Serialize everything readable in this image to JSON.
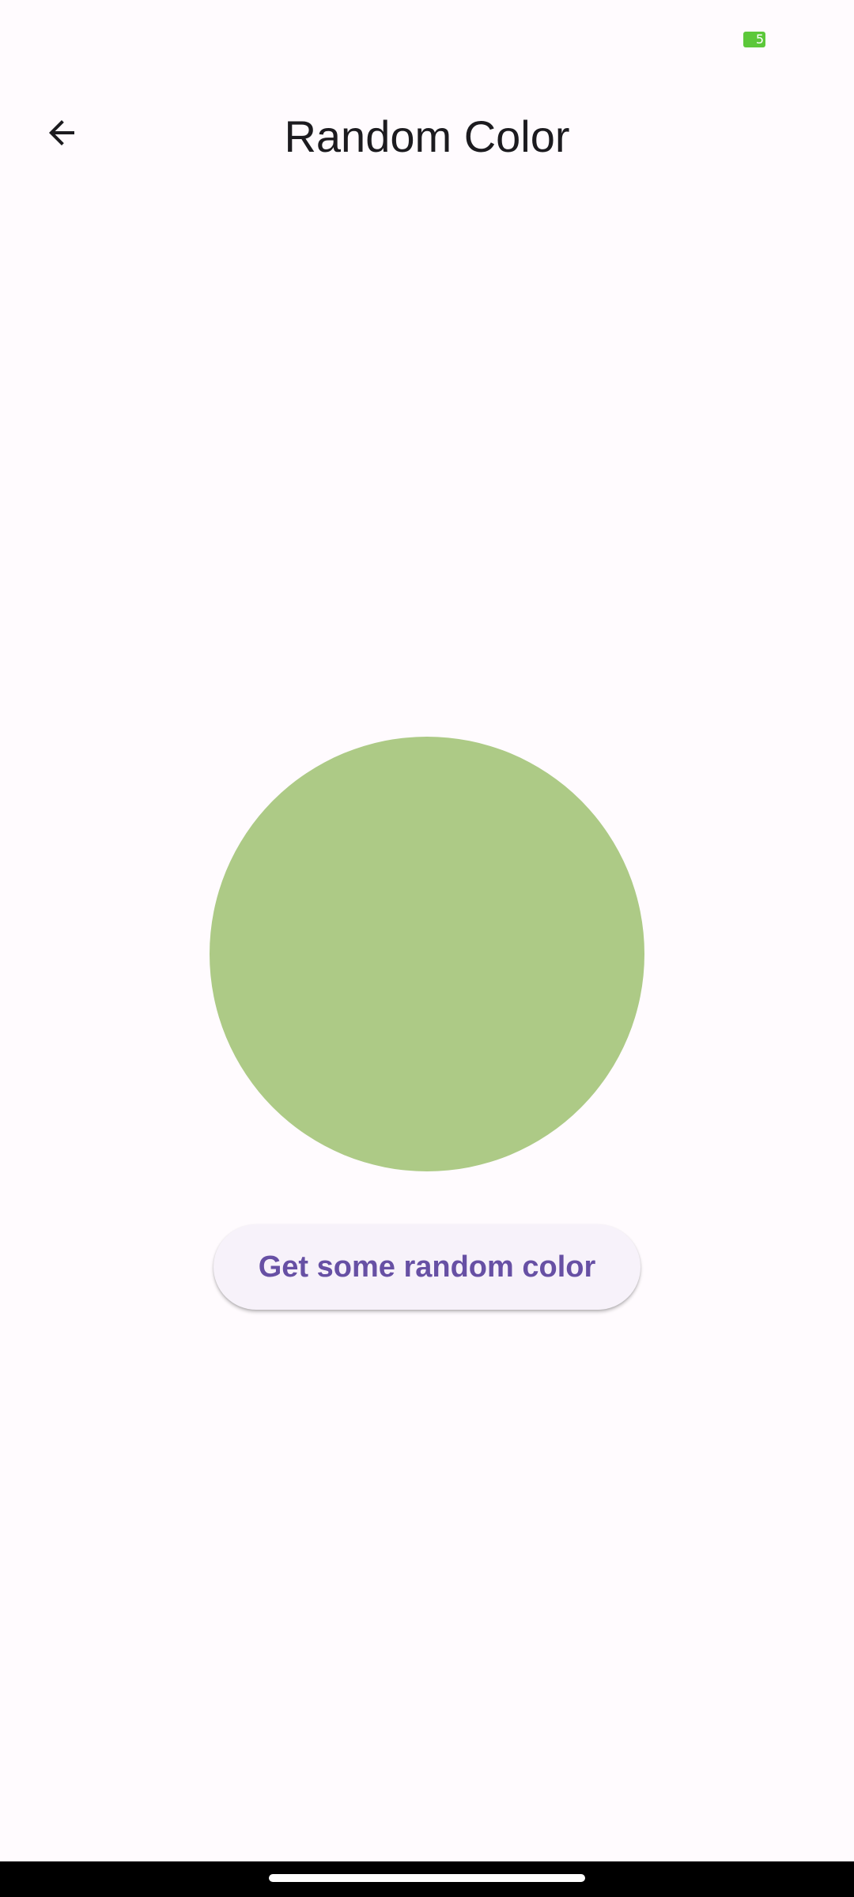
{
  "status_bar": {
    "battery_level": "5"
  },
  "app_bar": {
    "title": "Random Color",
    "back_icon": "arrow-back-icon"
  },
  "color_display": {
    "color": "#adca86"
  },
  "action": {
    "button_label": "Get some random color"
  },
  "colors": {
    "background": "#fffbfe",
    "accent": "#6750a4",
    "battery": "#5cc83a"
  }
}
